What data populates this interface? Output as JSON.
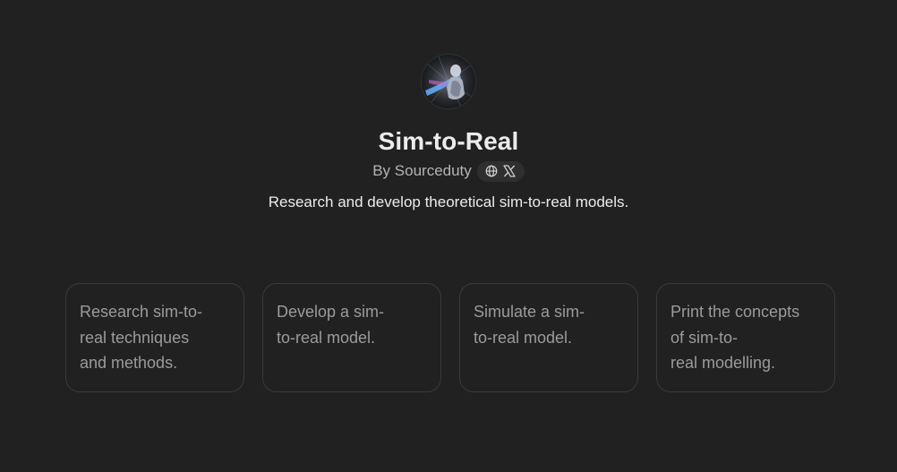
{
  "gpt": {
    "name": "Sim-to-Real",
    "author_prefix": "By",
    "author": "Sourceduty",
    "description": "Research and develop theoretical sim-to-real models.",
    "social_icons": [
      "globe-icon",
      "x-logo-icon"
    ]
  },
  "starters": [
    {
      "text": "Research sim-to-\nreal techniques\nand methods."
    },
    {
      "text": "Develop a sim-\nto-real model."
    },
    {
      "text": "Simulate a sim-\nto-real model."
    },
    {
      "text": "Print the concepts\nof sim-to-\nreal modelling."
    }
  ],
  "colors": {
    "background": "#212121",
    "title": "#ececec",
    "muted": "#b4b4b4",
    "card_text": "#9b9b9b",
    "card_border": "#3a3a3a",
    "pill": "#2f2f2f"
  }
}
